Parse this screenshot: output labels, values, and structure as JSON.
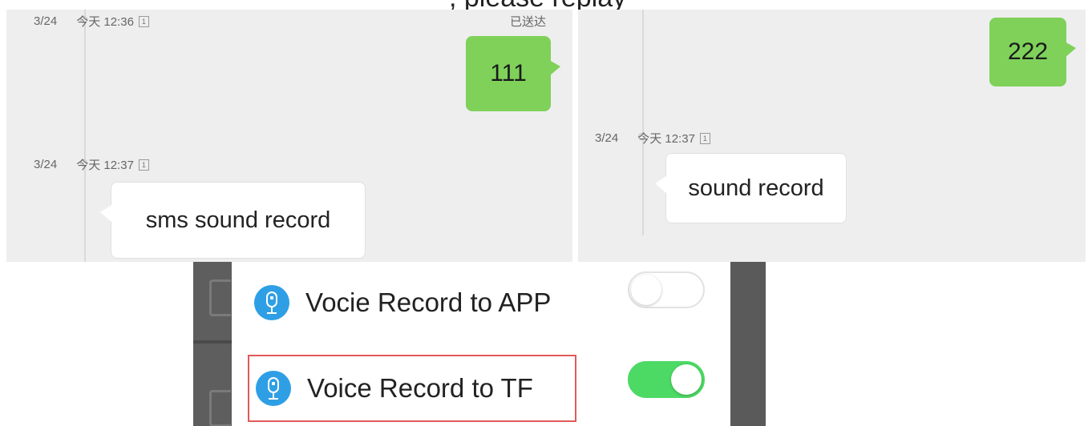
{
  "top_caption": ", please replay",
  "left_chat": {
    "messages": [
      {
        "date": "3/24",
        "time": "今天 12:36",
        "sim": "1",
        "status": "已送达",
        "direction": "outgoing",
        "text": "111"
      },
      {
        "date": "3/24",
        "time": "今天 12:37",
        "sim": "1",
        "direction": "incoming",
        "text": "sms sound record"
      }
    ]
  },
  "right_chat": {
    "messages": [
      {
        "direction": "outgoing",
        "text": "222"
      },
      {
        "date": "3/24",
        "time": "今天 12:37",
        "sim": "1",
        "direction": "incoming",
        "text": "sound record"
      }
    ]
  },
  "settings": {
    "items": [
      {
        "label": "Vocie Record to APP",
        "icon": "microphone-icon",
        "enabled": false,
        "highlighted": false
      },
      {
        "label": "Voice Record to TF",
        "icon": "microphone-icon",
        "enabled": true,
        "highlighted": true
      }
    ]
  },
  "colors": {
    "outgoing_bubble": "#7fd15a",
    "incoming_bubble": "#ffffff",
    "chat_background": "#eeeeee",
    "toggle_on": "#4cd964",
    "icon_blue": "#2f9fe5",
    "highlight_border": "#e05a5a"
  }
}
